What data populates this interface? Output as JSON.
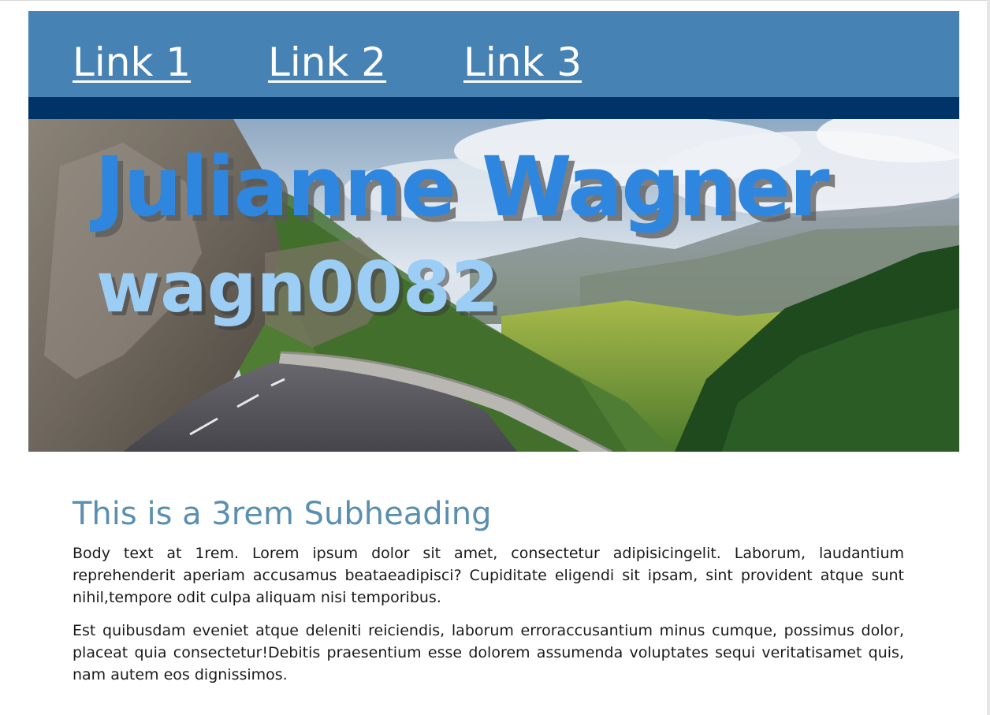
{
  "nav": {
    "links": [
      {
        "label": "Link 1"
      },
      {
        "label": "Link 2"
      },
      {
        "label": "Link 3"
      }
    ]
  },
  "hero": {
    "title": "Julianne Wagner",
    "subtitle": "wagn0082",
    "image": "mountain-road-landscape"
  },
  "main": {
    "subheading": "This is a 3rem Subheading",
    "paragraphs": [
      "Body text at 1rem. Lorem ipsum dolor sit amet, consectetur adipisicingelit. Laborum, laudantium reprehenderit aperiam accusamus beataeadipisci? Cupiditate eligendi sit ipsam, sint provident atque sunt nihil,tempore odit culpa aliquam nisi temporibus.",
      "Est quibusdam eveniet atque deleniti reiciendis, laborum erroraccusantium minus cumque, possimus dolor, placeat quia consectetur!Debitis praesentium esse dolorem assumenda voluptates sequi veritatisamet quis, nam autem eos dignissimos."
    ]
  },
  "colors": {
    "nav_background": "#4682b4",
    "nav_bar": "#003366",
    "title": "#2e86de",
    "subtitle": "#9ccdf5",
    "subheading": "#5a8fb0"
  }
}
